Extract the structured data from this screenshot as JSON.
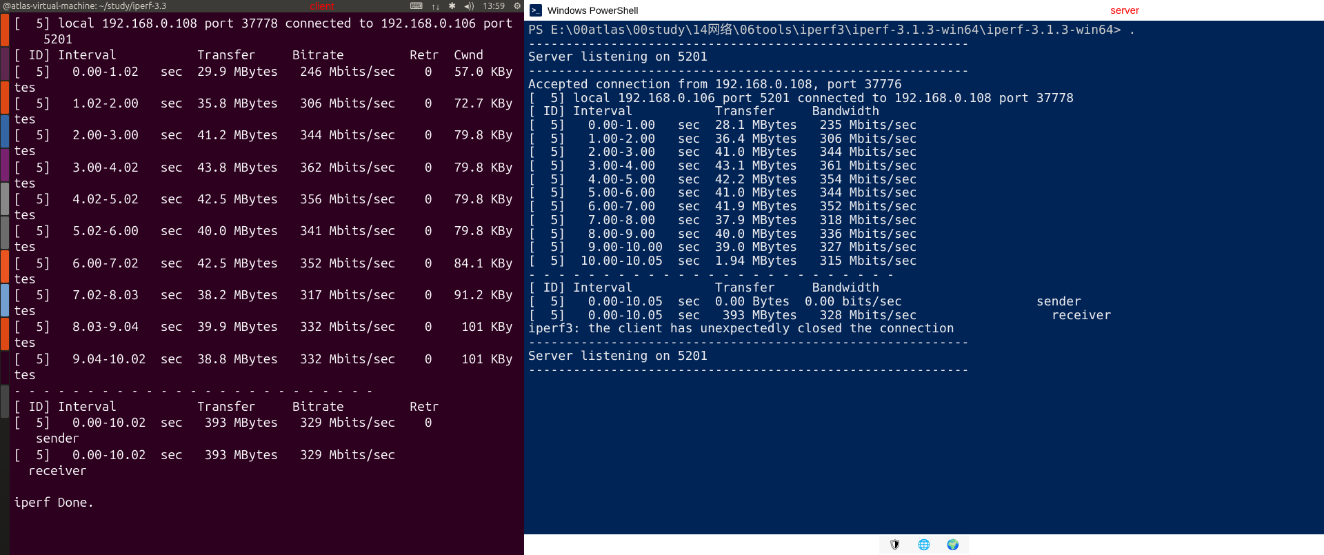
{
  "annotation": {
    "client": "client",
    "server": "server"
  },
  "ubuntu": {
    "title": "@atlas-virtual-machine: ~/study/iperf-3.3",
    "time": "13:59",
    "tray": {
      "input": "⌨",
      "net": "↑↓",
      "bt": "✱",
      "sound": "◂))",
      "gear": "⚙"
    }
  },
  "launcher_colors": [
    "#DD4814",
    "#5E2750",
    "#DD4814",
    "#3465A4",
    "#77216F",
    "#888888",
    "#6C6C6C",
    "#E95420",
    "#729FCF",
    "#DD4814",
    "#2C001E",
    "#444444"
  ],
  "powershell": {
    "title": "Windows PowerShell",
    "prompt": "PS E:\\00atlas\\00study\\14网络\\06tools\\iperf3\\iperf-3.1.3-win64\\iperf-3.1.3-win64> ."
  },
  "taskbar": {
    "shield": "🛡",
    "globe1": "🌐",
    "globe2": "🌍"
  },
  "client_term": {
    "connected": "[  5] local 192.168.0.108 port 37778 connected to 192.168.0.106 port",
    "connected_port": "    5201",
    "header": "[ ID] Interval           Transfer     Bitrate         Retr  Cwnd",
    "rows": [
      "[  5]   0.00-1.02   sec  29.9 MBytes   246 Mbits/sec    0   57.0 KBy",
      "tes",
      "[  5]   1.02-2.00   sec  35.8 MBytes   306 Mbits/sec    0   72.7 KBy",
      "tes",
      "[  5]   2.00-3.00   sec  41.2 MBytes   344 Mbits/sec    0   79.8 KBy",
      "tes",
      "[  5]   3.00-4.02   sec  43.8 MBytes   362 Mbits/sec    0   79.8 KBy",
      "tes",
      "[  5]   4.02-5.02   sec  42.5 MBytes   356 Mbits/sec    0   79.8 KBy",
      "tes",
      "[  5]   5.02-6.00   sec  40.0 MBytes   341 Mbits/sec    0   79.8 KBy",
      "tes",
      "[  5]   6.00-7.02   sec  42.5 MBytes   352 Mbits/sec    0   84.1 KBy",
      "tes",
      "[  5]   7.02-8.03   sec  38.2 MBytes   317 Mbits/sec    0   91.2 KBy",
      "tes",
      "[  5]   8.03-9.04   sec  39.9 MBytes   332 Mbits/sec    0    101 KBy",
      "tes",
      "[  5]   9.04-10.02  sec  38.8 MBytes   332 Mbits/sec    0    101 KBy",
      "tes"
    ],
    "sep": "- - - - - - - - - - - - - - - - - - - - - - - - -",
    "summary_hdr": "[ ID] Interval           Transfer     Bitrate         Retr",
    "summary1": "[  5]   0.00-10.02  sec   393 MBytes   329 Mbits/sec    0",
    "sender": "   sender",
    "summary2": "[  5]   0.00-10.02  sec   393 MBytes   329 Mbits/sec",
    "receiver": "  receiver",
    "done": "iperf Done."
  },
  "server_term": {
    "dash": "-----------------------------------------------------------",
    "listening": "Server listening on 5201",
    "accepted": "Accepted connection from 192.168.0.108, port 37776",
    "connected": "[  5] local 192.168.0.106 port 5201 connected to 192.168.0.108 port 37778",
    "header": "[ ID] Interval           Transfer     Bandwidth",
    "rows": [
      "[  5]   0.00-1.00   sec  28.1 MBytes   235 Mbits/sec",
      "[  5]   1.00-2.00   sec  36.4 MBytes   306 Mbits/sec",
      "[  5]   2.00-3.00   sec  41.0 MBytes   344 Mbits/sec",
      "[  5]   3.00-4.00   sec  43.1 MBytes   361 Mbits/sec",
      "[  5]   4.00-5.00   sec  42.2 MBytes   354 Mbits/sec",
      "[  5]   5.00-6.00   sec  41.0 MBytes   344 Mbits/sec",
      "[  5]   6.00-7.00   sec  41.9 MBytes   352 Mbits/sec",
      "[  5]   7.00-8.00   sec  37.9 MBytes   318 Mbits/sec",
      "[  5]   8.00-9.00   sec  40.0 MBytes   336 Mbits/sec",
      "[  5]   9.00-10.00  sec  39.0 MBytes   327 Mbits/sec",
      "[  5]  10.00-10.05  sec  1.94 MBytes   315 Mbits/sec"
    ],
    "sep": "- - - - - - - - - - - - - - - - - - - - - - - - -",
    "summary_hdr": "[ ID] Interval           Transfer     Bandwidth",
    "summary1": "[  5]   0.00-10.05  sec  0.00 Bytes  0.00 bits/sec                  sender",
    "summary2": "[  5]   0.00-10.05  sec   393 MBytes   328 Mbits/sec                  receiver",
    "closed": "iperf3: the client has unexpectedly closed the connection"
  }
}
